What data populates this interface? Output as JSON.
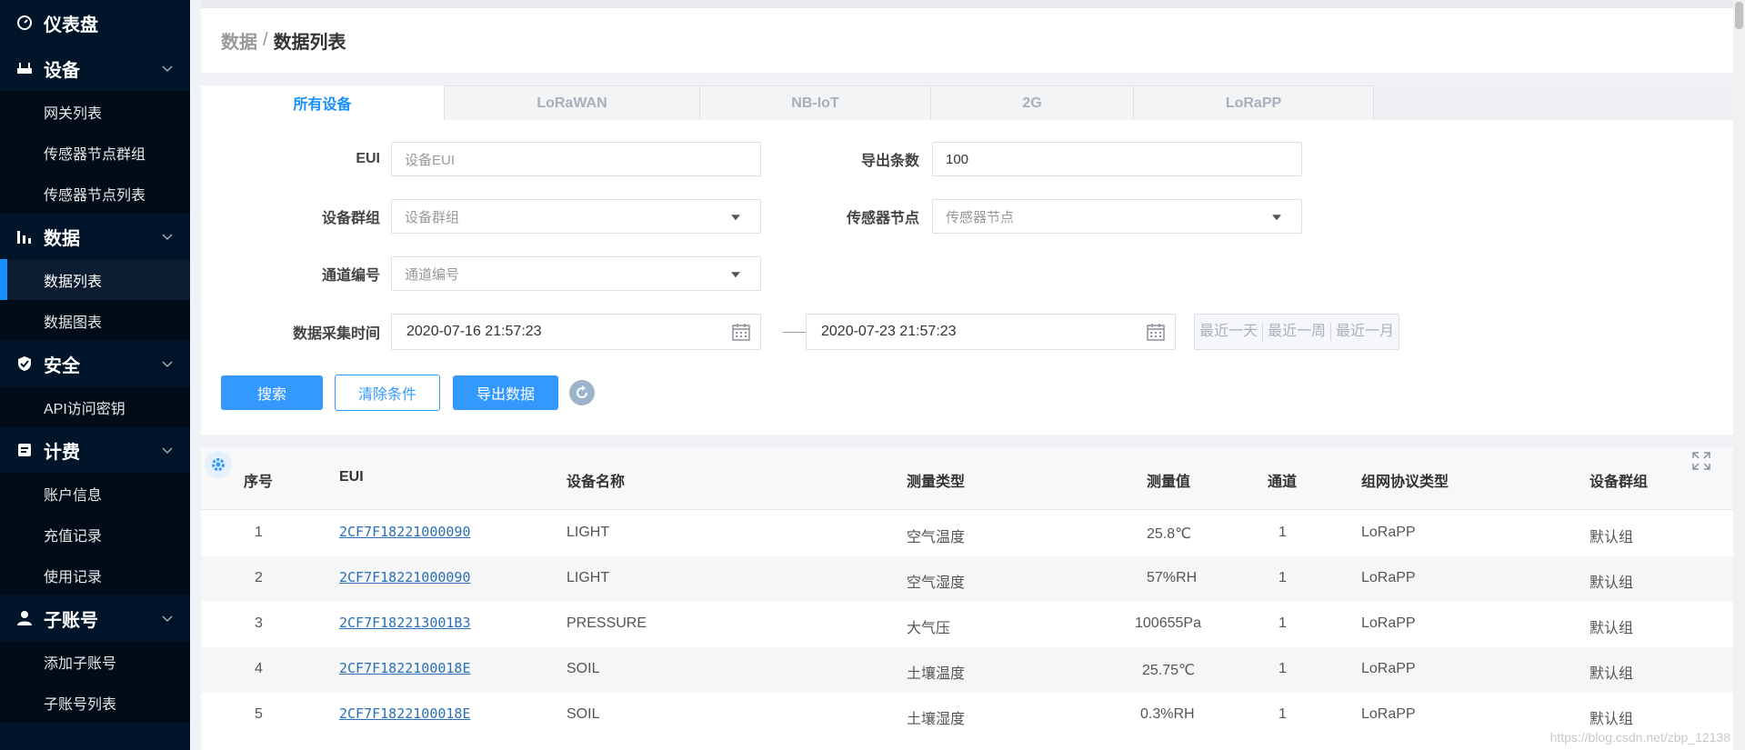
{
  "sidebar": {
    "dashboard": "仪表盘",
    "groups": [
      {
        "label": "设备",
        "items": [
          "网关列表",
          "传感器节点群组",
          "传感器节点列表"
        ]
      },
      {
        "label": "数据",
        "items": [
          "数据列表",
          "数据图表"
        ]
      },
      {
        "label": "安全",
        "items": [
          "API访问密钥"
        ]
      },
      {
        "label": "计费",
        "items": [
          "账户信息",
          "充值记录",
          "使用记录"
        ]
      },
      {
        "label": "子账号",
        "items": [
          "添加子账号",
          "子账号列表"
        ]
      }
    ]
  },
  "breadcrumb": {
    "parent": "数据",
    "separator": "/",
    "current": "数据列表"
  },
  "tabs": [
    "所有设备",
    "LoRaWAN",
    "NB-IoT",
    "2G",
    "LoRaPP"
  ],
  "form": {
    "eui": {
      "label": "EUI",
      "placeholder": "设备EUI"
    },
    "export_count": {
      "label": "导出条数",
      "value": "100"
    },
    "device_group": {
      "label": "设备群组",
      "placeholder": "设备群组"
    },
    "sensor_node": {
      "label": "传感器节点",
      "placeholder": "传感器节点"
    },
    "channel": {
      "label": "通道编号",
      "placeholder": "通道编号"
    },
    "time": {
      "label": "数据采集时间",
      "start": "2020-07-16 21:57:23",
      "end": "2020-07-23 21:57:23"
    },
    "quick": [
      "最近一天",
      "最近一周",
      "最近一月"
    ]
  },
  "buttons": {
    "search": "搜索",
    "clear": "清除条件",
    "export": "导出数据"
  },
  "table": {
    "headers": [
      "序号",
      "EUI",
      "设备名称",
      "测量类型",
      "测量值",
      "通道",
      "组网协议类型",
      "设备群组"
    ],
    "rows": [
      [
        "1",
        "2CF7F18221000090",
        "LIGHT",
        "空气温度",
        "25.8℃",
        "1",
        "LoRaPP",
        "默认组"
      ],
      [
        "2",
        "2CF7F18221000090",
        "LIGHT",
        "空气湿度",
        "57%RH",
        "1",
        "LoRaPP",
        "默认组"
      ],
      [
        "3",
        "2CF7F182213001B3",
        "PRESSURE",
        "大气压",
        "100655Pa",
        "1",
        "LoRaPP",
        "默认组"
      ],
      [
        "4",
        "2CF7F1822100018E",
        "SOIL",
        "土壤温度",
        "25.75℃",
        "1",
        "LoRaPP",
        "默认组"
      ],
      [
        "5",
        "2CF7F1822100018E",
        "SOIL",
        "土壤湿度",
        "0.3%RH",
        "1",
        "LoRaPP",
        "默认组"
      ]
    ]
  },
  "watermark": "https://blog.csdn.net/zbp_12138",
  "colors": {
    "sidebar_bg": "#001529",
    "accent": "#1890ff",
    "primary_button": "#3399ff"
  }
}
